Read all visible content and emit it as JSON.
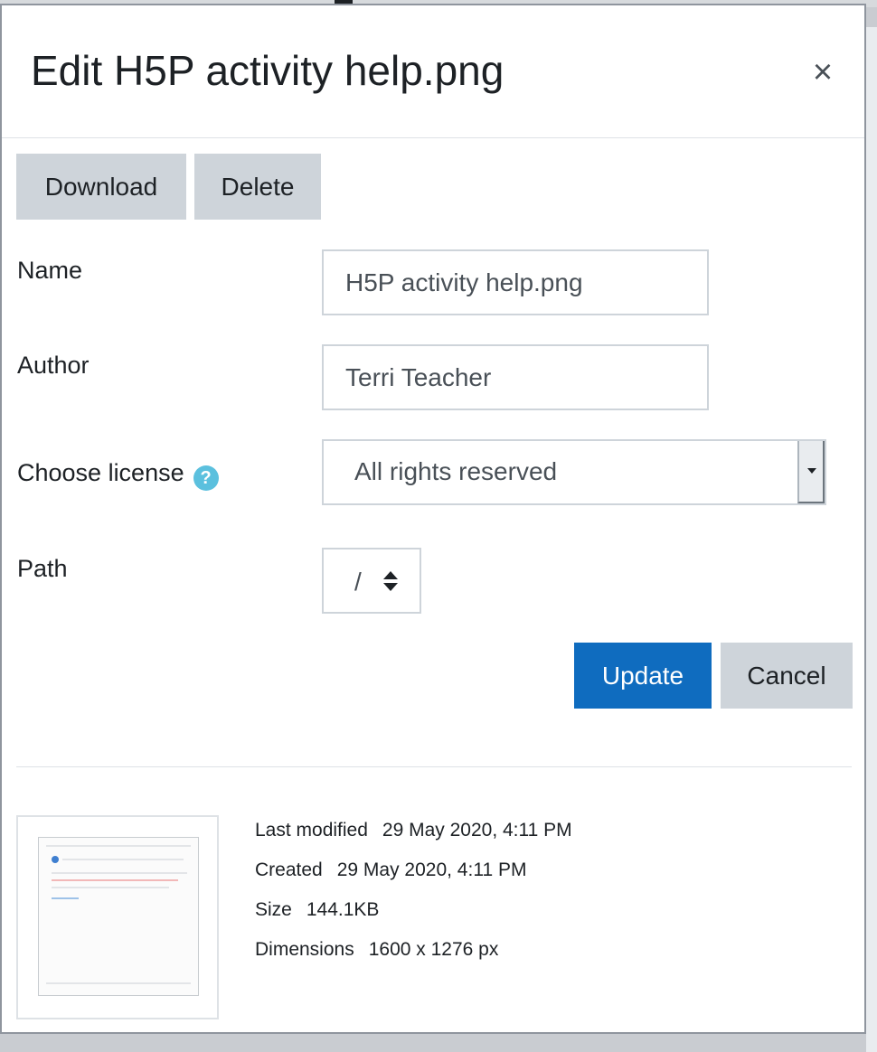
{
  "dialog": {
    "title": "Edit H5P activity help.png",
    "close_symbol": "×"
  },
  "actions": {
    "download_label": "Download",
    "delete_label": "Delete"
  },
  "form": {
    "name_label": "Name",
    "name_value": "H5P activity help.png",
    "author_label": "Author",
    "author_value": "Terri Teacher",
    "license_label": "Choose license",
    "license_help_symbol": "?",
    "license_value": "All rights reserved",
    "path_label": "Path",
    "path_value": "/"
  },
  "footer": {
    "update_label": "Update",
    "cancel_label": "Cancel"
  },
  "file_info": {
    "last_modified_label": "Last modified",
    "last_modified_value": "29 May 2020, 4:11 PM",
    "created_label": "Created",
    "created_value": "29 May 2020, 4:11 PM",
    "size_label": "Size",
    "size_value": "144.1KB",
    "dimensions_label": "Dimensions",
    "dimensions_value": "1600 x 1276 px"
  },
  "icons": {
    "close": "close-icon",
    "help": "help-icon",
    "dropdown": "caret-down-icon",
    "path_selector": "up-down-arrows-icon"
  },
  "colors": {
    "primary": "#0f6cbf",
    "secondary": "#ced4da",
    "help": "#5bc0de"
  }
}
